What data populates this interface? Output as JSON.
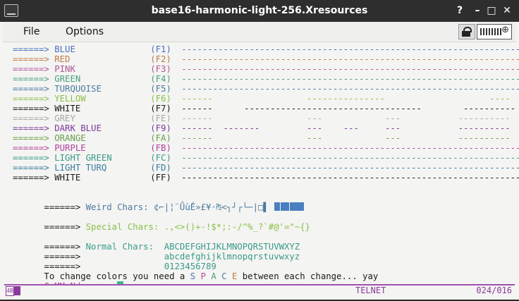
{
  "window": {
    "title": "base16-harmonic-light-256.Xresources"
  },
  "menu": {
    "file": "File",
    "options": "Options"
  },
  "rows": [
    {
      "arrow": "======>",
      "name": "BLUE",
      "key": "(F1)",
      "color": "#4a6fc0",
      "dashes": "-----------------------------------------------------------------"
    },
    {
      "arrow": "======>",
      "name": "RED",
      "key": "(F2)",
      "color": "#c07a4a",
      "dashes": "-----------------------------------------------------------------"
    },
    {
      "arrow": "======>",
      "name": "PINK",
      "key": "(F3)",
      "color": "#b0559a",
      "dashes": "-----------------------------------------------------------------"
    },
    {
      "arrow": "======>",
      "name": "GREEN",
      "key": "(F4)",
      "color": "#4aa080",
      "dashes": "-----------------------------------------------------------------"
    },
    {
      "arrow": "======>",
      "name": "TURQUOISE",
      "key": "(F5)",
      "color": "#4a7aa0",
      "dashes": "-----------------------------------------------------------------"
    },
    {
      "arrow": "======>",
      "name": "YELLOW",
      "key": "(F6)",
      "color": "#8ac04a",
      "dashes": "------                  ---------------                    ----"
    },
    {
      "arrow": "======>",
      "name": "WHITE",
      "key": "(F7)",
      "color": "#1a1a1a",
      "dashes": "------      ----------------------------------        ----------"
    },
    {
      "arrow": "======>",
      "name": "GREY",
      "key": "(FE)",
      "color": "#a8a8a8",
      "dashes": "------                  ---            ---           ----------"
    },
    {
      "arrow": "======>",
      "name": "DARK BLUE",
      "key": "(F9)",
      "color": "#7a3a9a",
      "dashes": "------  -------         ---    ---     ---           ----------"
    },
    {
      "arrow": "======>",
      "name": "ORANGE",
      "key": "(FA)",
      "color": "#6aa04a",
      "dashes": "------                  ---            ---           ----------"
    },
    {
      "arrow": "======>",
      "name": "PURPLE",
      "key": "(FB)",
      "color": "#b0409a",
      "dashes": "-----------------------------------------------------------------"
    },
    {
      "arrow": "======>",
      "name": "LIGHT GREEN",
      "key": "(FC)",
      "color": "#3a9a8a",
      "dashes": "-----------------------------------------------------------------"
    },
    {
      "arrow": "======>",
      "name": "LIGHT TURQ",
      "key": "(FD)",
      "color": "#3a7aa0",
      "dashes": "-----------------------------------------------------------------"
    },
    {
      "arrow": "======>",
      "name": "WHITE",
      "key": "(FF)",
      "color": "#1a1a1a",
      "dashes": "-----------------------------------------------------------------"
    }
  ],
  "weird": {
    "arrow": "======>",
    "label": "Weird Chars:",
    "chars": "¢⌐|¦¨Ǘù̃É»£¥·₧<┐┘┌└─|□▌"
  },
  "special": {
    "arrow": "======>",
    "label": "Special Chars:",
    "chars": ".,<>()+-!$*;:-/^%_?`#@'=\"~{}"
  },
  "normal": {
    "arrow": "======>",
    "label": "Normal Chars:",
    "upper": "ABCDEFGHIJKLMNOPQRSTUVWXYZ",
    "lower": "abcdefghijklmnopqrstuvwxyz",
    "digits": "0123456789"
  },
  "info": {
    "prefix": "To change colors you need a ",
    "s": "S",
    "p": "P",
    "a": "A",
    "c": "C",
    "e": "E",
    "suffix": " between each change... yay"
  },
  "command": {
    "prompt": "CoMMaNd ===>"
  },
  "status": {
    "badge": "4B",
    "mode": "TELNET",
    "position": "024/016"
  },
  "colors": {
    "arrow": "#1a1a1a",
    "label_green": "#4aa080",
    "weird_label": "#4a7aa0",
    "special_label": "#8ac04a",
    "normal_label": "#3a9a8a",
    "normal_chars": "#3a9a8a",
    "prompt": "#b0409a",
    "cursor": "#3ab98a",
    "status": "#8a3a9a"
  }
}
